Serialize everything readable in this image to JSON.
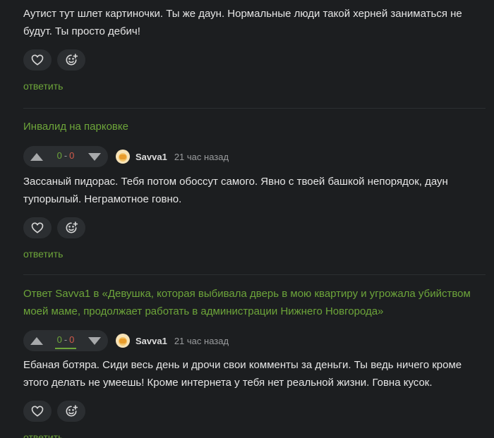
{
  "comments": [
    {
      "text": "Аутист тут шлет картиночки. Ты же даун. Нормальные люди такой херней заниматься не будут. Ты просто дебич!",
      "reply_label": "ответить"
    },
    {
      "thread_title": "Инвалид на парковке",
      "vote": {
        "plus": "0",
        "separator": "-",
        "minus": "0"
      },
      "author": "Savva1",
      "time": "21 час назад",
      "text": "Зассаный пидорас. Тебя потом обоссут самого. Явно с твоей башкой непорядок, даун тупорылый. Неграмотное говно.",
      "reply_label": "ответить"
    },
    {
      "thread_title": "Ответ Savva1 в «Девушка, которая выбивала дверь в мою квартиру и угрожала убийством моей маме, продолжает работать в администрации Нижнего Новгорода»",
      "vote": {
        "plus": "0",
        "separator": "-",
        "minus": "0"
      },
      "author": "Savva1",
      "time": "21 час назад",
      "text": "Ебаная ботяра. Сиди весь день и дрочи свои комменты за деньги. Ты ведь ничего кроме этого делать не умеешь! Кроме интернета у тебя нет реальной жизни. Говна кусок.",
      "reply_label": "ответить"
    }
  ],
  "icons": {
    "like": "heart-icon",
    "react": "smiley-add-icon",
    "vote_up": "triangle-up-icon",
    "vote_down": "triangle-down-icon"
  },
  "colors": {
    "background": "#1c1e20",
    "accent_green": "#6da53a",
    "minus_red": "#d35a4a",
    "button_bg": "#2b2e31"
  }
}
